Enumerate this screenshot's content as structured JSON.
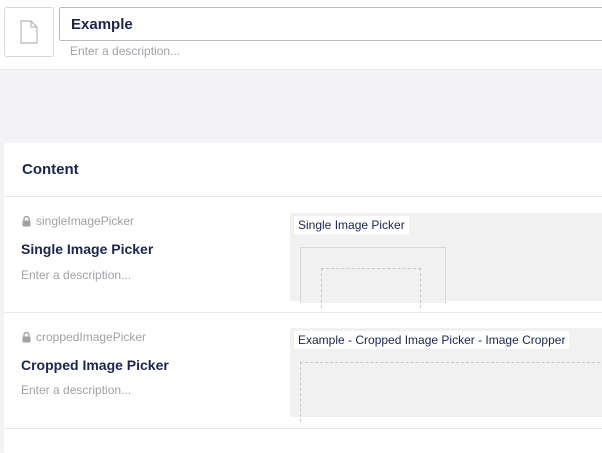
{
  "header": {
    "name_value": "Example",
    "description_placeholder": "Enter a description...",
    "doc_icon": "document-icon"
  },
  "content": {
    "title": "Content",
    "properties": [
      {
        "alias": "singleImagePicker",
        "label": "Single Image Picker",
        "description": "Enter a description...",
        "editor_label": "Single Image Picker",
        "lock_icon": "lock-icon"
      },
      {
        "alias": "croppedImagePicker",
        "label": "Cropped Image Picker",
        "description": "Enter a description...",
        "editor_label": "Example - Cropped Image Picker - Image Cropper",
        "lock_icon": "lock-icon"
      }
    ]
  },
  "colors": {
    "text": "#1b264f",
    "muted": "#a2a1a6",
    "background": "#f3f3f5",
    "editor_bg": "#f1f1f2"
  }
}
